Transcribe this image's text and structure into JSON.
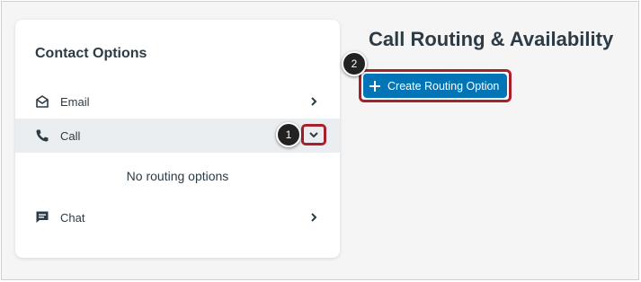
{
  "left_panel": {
    "title": "Contact Options",
    "items": [
      {
        "label": "Email",
        "icon": "envelope-icon",
        "state": "collapsed"
      },
      {
        "label": "Call",
        "icon": "phone-icon",
        "state": "expanded"
      },
      {
        "label": "Chat",
        "icon": "chat-icon",
        "state": "collapsed"
      }
    ],
    "call_expanded_text": "No routing options"
  },
  "main": {
    "heading": "Call Routing & Availability",
    "create_button_label": "Create Routing Option"
  },
  "markers": {
    "one": "1",
    "two": "2"
  },
  "colors": {
    "accent_button": "#0374b5",
    "highlight_outline": "#a8202c",
    "text": "#2d3b45",
    "selected_row": "#ebeef0"
  }
}
